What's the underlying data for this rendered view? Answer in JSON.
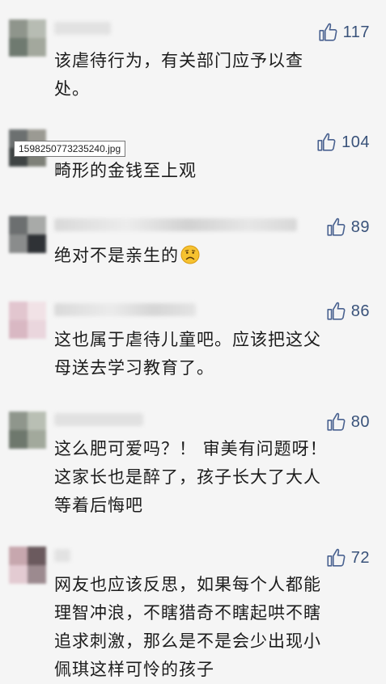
{
  "tooltip": "1598250773235240.jpg",
  "comments": [
    {
      "likes": "117",
      "lines": [
        "该虐待行为，有关部门应予以查",
        "处。"
      ]
    },
    {
      "likes": "104",
      "lines": [
        "畸形的金钱至上观"
      ]
    },
    {
      "likes": "89",
      "lines": [
        "绝对不是亲生的"
      ],
      "emoji": "frowning-face-emoji"
    },
    {
      "likes": "86",
      "lines": [
        "这也属于虐待儿童吧。应该把这父",
        "母送去学习教育了。"
      ]
    },
    {
      "likes": "80",
      "lines": [
        "这么肥可爱吗？！ 审美有问题呀！",
        "这家长也是醉了，孩子长大了大人",
        "等着后悔吧"
      ]
    },
    {
      "likes": "72",
      "lines": [
        "网友也应该反思，如果每个人都能",
        "理智冲浪，不瞎猎奇不瞎起哄不瞎",
        "追求刺激，那么是不是会少出现小",
        "佩琪这样可怜的孩子"
      ]
    }
  ],
  "colors": {
    "background": "#f5f5f5",
    "like_count": "#39527a",
    "like_icon": "#4a6290",
    "text": "#1c1c1c"
  },
  "icons": {
    "like": "thumbs-up-icon"
  }
}
